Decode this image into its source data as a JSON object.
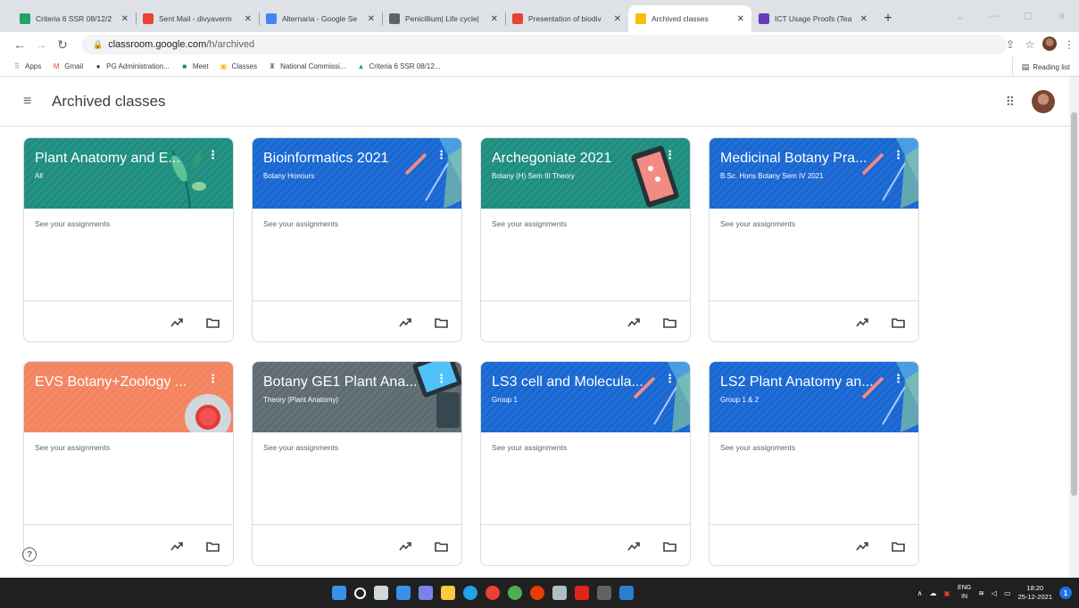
{
  "browser": {
    "tabs": [
      {
        "title": "Criteria 6 SSR 08/12/2",
        "favicon_color": "#1fa463"
      },
      {
        "title": "Sent Mail - divyaverm",
        "favicon_color": "#ea4335"
      },
      {
        "title": "Alternaria - Google Se",
        "favicon_color": "#4285f4"
      },
      {
        "title": "Penicillium| Life cycle|",
        "favicon_color": "#5f6368"
      },
      {
        "title": "Presentation of biodiv",
        "favicon_color": "#ea4335"
      },
      {
        "title": "Archived classes",
        "favicon_color": "#fbbc04",
        "active": true
      },
      {
        "title": "ICT Usage Proofs (Tea",
        "favicon_color": "#673ab7"
      }
    ],
    "url_host": "classroom.google.com",
    "url_path": "/h/archived",
    "bookmarks": [
      {
        "label": "Apps",
        "icon": "apps-grid-icon",
        "color": "#4285f4"
      },
      {
        "label": "Gmail",
        "icon": "gmail-icon",
        "color": "#ea4335"
      },
      {
        "label": "PG Administration...",
        "icon": "globe-icon",
        "color": "#3c4043"
      },
      {
        "label": "Meet",
        "icon": "meet-icon",
        "color": "#00897b"
      },
      {
        "label": "Classes",
        "icon": "classroom-icon",
        "color": "#fbbc04"
      },
      {
        "label": "National Commissi...",
        "icon": "emblem-icon",
        "color": "#8d6e63"
      },
      {
        "label": "Criteria 6 SSR 08/12...",
        "icon": "drive-icon",
        "color": "#1fa463"
      }
    ],
    "reading_list": "Reading list"
  },
  "header": {
    "title": "Archived classes"
  },
  "cards": [
    {
      "name": "Plant Anatomy and E...",
      "section": "All",
      "body": "See your assignments",
      "color": "#1e8e7e",
      "theme": "plant"
    },
    {
      "name": "Bioinformatics 2021",
      "section": "Botany Honours",
      "body": "See your assignments",
      "color": "#1967d2",
      "theme": "pencil"
    },
    {
      "name": "Archegoniate 2021",
      "section": "Botany (H) Sem III Theory",
      "body": "See your assignments",
      "color": "#1e8e7e",
      "theme": "tablet"
    },
    {
      "name": "Medicinal Botany Pra...",
      "section": "B.Sc. Hons Botany Sem IV 2021",
      "body": "See your assignments",
      "color": "#1967d2",
      "theme": "pencil"
    },
    {
      "name": "EVS Botany+Zoology ...",
      "section": "",
      "body": "See your assignments",
      "color": "#f4845f",
      "theme": "record"
    },
    {
      "name": "Botany GE1 Plant Ana...",
      "section": "Theory (Plant Anatomy)",
      "body": "See your assignments",
      "color": "#5f6b73",
      "theme": "devices"
    },
    {
      "name": "LS3 cell and Molecula...",
      "section": "Group 1",
      "body": "See your assignments",
      "color": "#1967d2",
      "theme": "pencil"
    },
    {
      "name": "LS2 Plant Anatomy an...",
      "section": "Group 1 & 2",
      "body": "See your assignments",
      "color": "#1967d2",
      "theme": "pencil"
    }
  ],
  "taskbar": {
    "icons": [
      {
        "name": "start-icon",
        "color": "#3b8eea"
      },
      {
        "name": "search-icon",
        "color": "#ffffff"
      },
      {
        "name": "task-view-icon",
        "color": "#cfd8dc"
      },
      {
        "name": "widgets-icon",
        "color": "#3b8eea"
      },
      {
        "name": "teams-chat-icon",
        "color": "#7b83eb"
      },
      {
        "name": "file-explorer-icon",
        "color": "#ffc83d"
      },
      {
        "name": "edge-icon",
        "color": "#1fa2e6"
      },
      {
        "name": "chrome-icon",
        "color": "#e94235"
      },
      {
        "name": "chrome-profile-icon",
        "color": "#4caf50"
      },
      {
        "name": "office-icon",
        "color": "#eb3c00"
      },
      {
        "name": "settings-app-icon",
        "color": "#b0bec5"
      },
      {
        "name": "acrobat-icon",
        "color": "#e2231a"
      },
      {
        "name": "photos-icon",
        "color": "#5f6368"
      },
      {
        "name": "word-icon",
        "color": "#2b7cd3"
      }
    ],
    "lang_line1": "ENG",
    "lang_line2": "IN",
    "time": "18:20",
    "date": "25-12-2021",
    "notification_count": "1"
  }
}
